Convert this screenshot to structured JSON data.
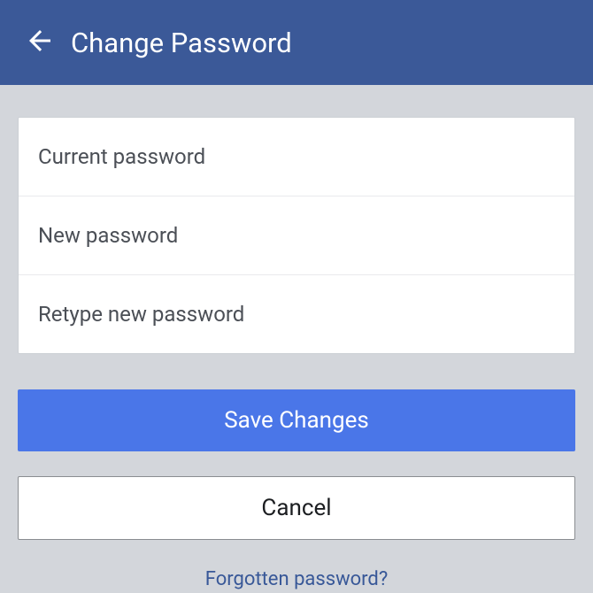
{
  "header": {
    "title": "Change Password"
  },
  "form": {
    "current_placeholder": "Current password",
    "new_placeholder": "New password",
    "retype_placeholder": "Retype new password"
  },
  "buttons": {
    "save_label": "Save Changes",
    "cancel_label": "Cancel"
  },
  "links": {
    "forgotten_label": "Forgotten password?"
  }
}
